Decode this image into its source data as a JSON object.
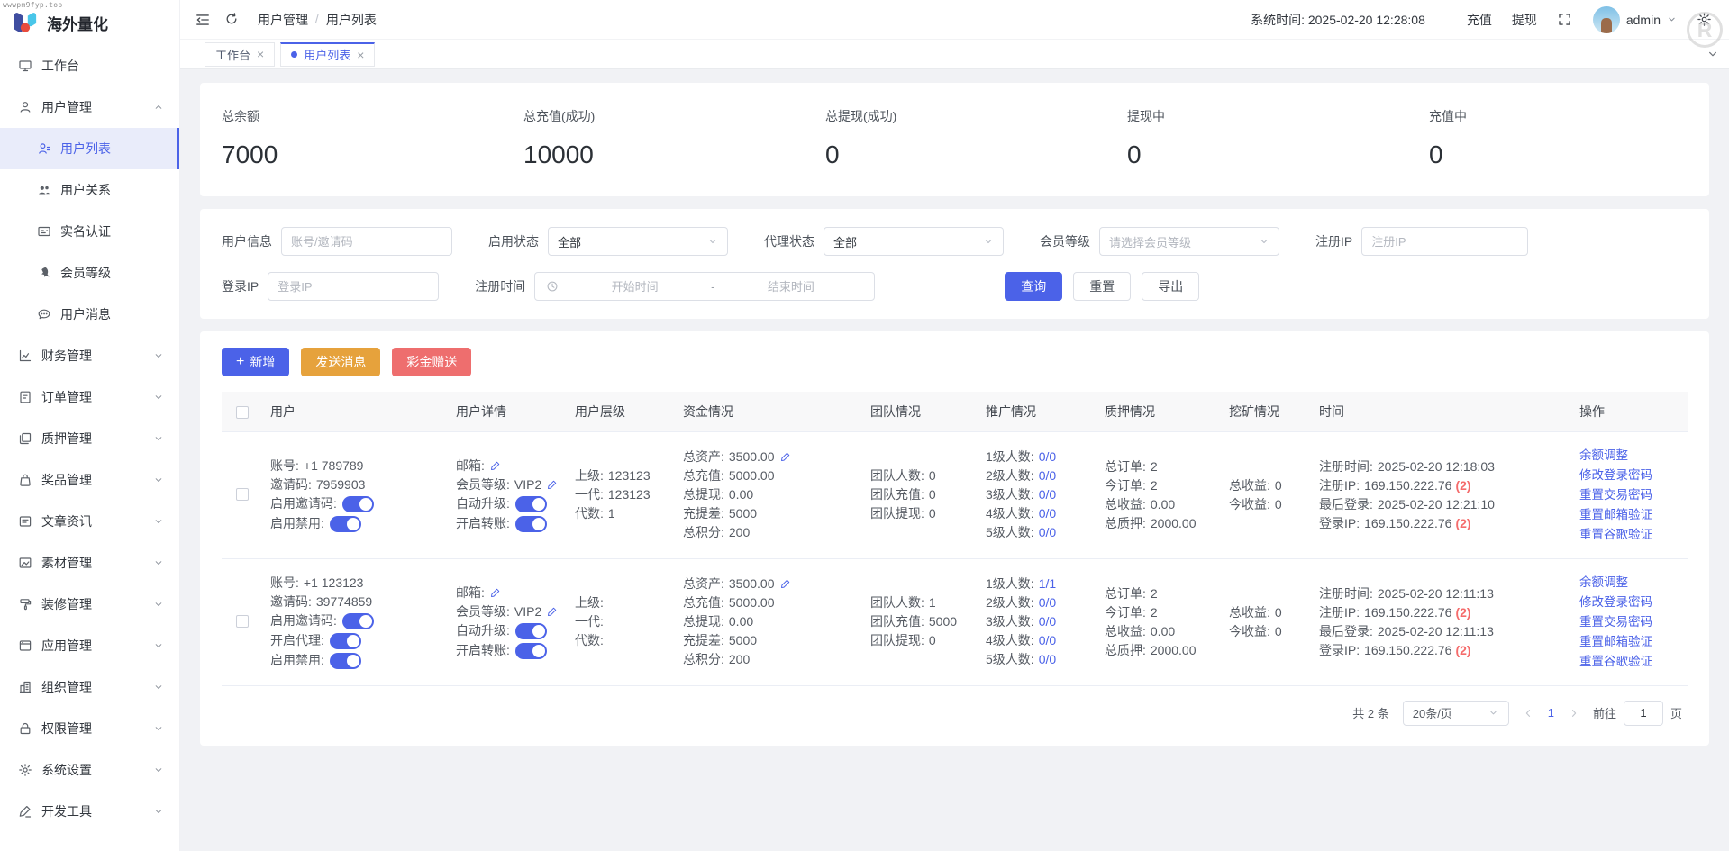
{
  "watermarks": {
    "top_left": "wwwpm9fyp.top",
    "top_right_letter": "R"
  },
  "colors": {
    "primary": "#4b62e8",
    "warning": "#e6a23c",
    "danger": "#ee6e6e",
    "badge_red": "#f56c6c"
  },
  "brand": {
    "name": "海外量化"
  },
  "sidebar": {
    "items": [
      {
        "id": "workbench",
        "label": "工作台",
        "icon": "monitor"
      },
      {
        "id": "user-management",
        "label": "用户管理",
        "icon": "user",
        "group": true,
        "expanded": true
      },
      {
        "id": "user-list",
        "label": "用户列表",
        "icon": "user-list",
        "sub": true,
        "active": true
      },
      {
        "id": "user-relation",
        "label": "用户关系",
        "icon": "users",
        "sub": true
      },
      {
        "id": "real-name-auth",
        "label": "实名认证",
        "icon": "idcard",
        "sub": true
      },
      {
        "id": "member-level",
        "label": "会员等级",
        "icon": "rocket",
        "sub": true
      },
      {
        "id": "user-message",
        "label": "用户消息",
        "icon": "chat",
        "sub": true
      },
      {
        "id": "finance-management",
        "label": "财务管理",
        "icon": "chart",
        "group": true
      },
      {
        "id": "order-management",
        "label": "订单管理",
        "icon": "order",
        "group": true
      },
      {
        "id": "pledge-management",
        "label": "质押管理",
        "icon": "pledge",
        "group": true
      },
      {
        "id": "prize-management",
        "label": "奖品管理",
        "icon": "bag",
        "group": true
      },
      {
        "id": "article-news",
        "label": "文章资讯",
        "icon": "article",
        "group": true
      },
      {
        "id": "material-management",
        "label": "素材管理",
        "icon": "image",
        "group": true
      },
      {
        "id": "decoration-management",
        "label": "装修管理",
        "icon": "paint",
        "group": true
      },
      {
        "id": "app-management",
        "label": "应用管理",
        "icon": "app",
        "group": true
      },
      {
        "id": "org-management",
        "label": "组织管理",
        "icon": "org",
        "group": true
      },
      {
        "id": "permission-management",
        "label": "权限管理",
        "icon": "lock",
        "group": true
      },
      {
        "id": "system-settings",
        "label": "系统设置",
        "icon": "gear",
        "group": true
      },
      {
        "id": "dev-tools",
        "label": "开发工具",
        "icon": "pen",
        "group": true
      }
    ]
  },
  "header": {
    "breadcrumb": [
      "用户管理",
      "用户列表"
    ],
    "system_time_label": "系统时间:",
    "system_time": "2025-02-20 12:28:08",
    "recharge_label": "充值",
    "withdraw_label": "提现",
    "username": "admin",
    "icons": [
      "collapse-menu",
      "refresh",
      "fullscreen",
      "settings-gear"
    ]
  },
  "tabs": [
    {
      "label": "工作台"
    },
    {
      "label": "用户列表",
      "active": true
    }
  ],
  "stats": [
    {
      "label": "总余额",
      "value": "7000"
    },
    {
      "label": "总充值(成功)",
      "value": "10000"
    },
    {
      "label": "总提现(成功)",
      "value": "0"
    },
    {
      "label": "提现中",
      "value": "0"
    },
    {
      "label": "充值中",
      "value": "0"
    }
  ],
  "filters": {
    "user_info": {
      "label": "用户信息",
      "placeholder": "账号/邀请码"
    },
    "enable_status": {
      "label": "启用状态",
      "value": "全部"
    },
    "agent_status": {
      "label": "代理状态",
      "value": "全部"
    },
    "member_level": {
      "label": "会员等级",
      "placeholder": "请选择会员等级"
    },
    "reg_ip": {
      "label": "注册IP",
      "placeholder": "注册IP"
    },
    "login_ip": {
      "label": "登录IP",
      "placeholder": "登录IP"
    },
    "reg_time": {
      "label": "注册时间",
      "start_placeholder": "开始时间",
      "separator": "-",
      "end_placeholder": "结束时间"
    },
    "search_label": "查询",
    "reset_label": "重置",
    "export_label": "导出"
  },
  "toolbar": {
    "add_label": "新增",
    "send_message_label": "发送消息",
    "bonus_label": "彩金赠送"
  },
  "table": {
    "headers": [
      "用户",
      "用户详情",
      "用户层级",
      "资金情况",
      "团队情况",
      "推广情况",
      "质押情况",
      "挖矿情况",
      "时间",
      "操作"
    ],
    "rows": [
      {
        "user": {
          "lines": [
            {
              "k": "账号:",
              "v": "+1 789789"
            },
            {
              "k": "邀请码:",
              "v": "7959903"
            }
          ],
          "toggles": [
            "启用邀请码:",
            "启用禁用:"
          ]
        },
        "detail": {
          "email_k": "邮箱:",
          "level_k": "会员等级:",
          "level_v": "VIP2",
          "toggles": [
            "自动升级:",
            "开启转账:"
          ]
        },
        "hierarchy": [
          {
            "k": "上级:",
            "v": "123123"
          },
          {
            "k": "一代:",
            "v": "123123"
          },
          {
            "k": "代数:",
            "v": "1"
          }
        ],
        "funds": [
          {
            "k": "总资产:",
            "v": "3500.00",
            "edit": true
          },
          {
            "k": "总充值:",
            "v": "5000.00"
          },
          {
            "k": "总提现:",
            "v": "0.00"
          },
          {
            "k": "充提差:",
            "v": "5000"
          },
          {
            "k": "总积分:",
            "v": "200"
          }
        ],
        "team": [
          {
            "k": "团队人数:",
            "v": "0"
          },
          {
            "k": "团队充值:",
            "v": "0"
          },
          {
            "k": "团队提现:",
            "v": "0"
          }
        ],
        "promotion": [
          {
            "k": "1级人数:",
            "v": "0/0"
          },
          {
            "k": "2级人数:",
            "v": "0/0"
          },
          {
            "k": "3级人数:",
            "v": "0/0"
          },
          {
            "k": "4级人数:",
            "v": "0/0"
          },
          {
            "k": "5级人数:",
            "v": "0/0"
          }
        ],
        "pledge": [
          {
            "k": "总订单:",
            "v": "2"
          },
          {
            "k": "今订单:",
            "v": "2"
          },
          {
            "k": "总收益:",
            "v": "0.00"
          },
          {
            "k": "总质押:",
            "v": "2000.00"
          }
        ],
        "mining": [
          {
            "k": "总收益:",
            "v": "0"
          },
          {
            "k": "今收益:",
            "v": "0"
          }
        ],
        "time": [
          {
            "k": "注册时间:",
            "v": "2025-02-20 12:18:03"
          },
          {
            "k": "注册IP:",
            "v": "169.150.222.76",
            "badge": "(2)"
          },
          {
            "k": "最后登录:",
            "v": "2025-02-20 12:21:10"
          },
          {
            "k": "登录IP:",
            "v": "169.150.222.76",
            "badge": "(2)"
          }
        ],
        "actions": [
          "余额调整",
          "修改登录密码",
          "重置交易密码",
          "重置邮箱验证",
          "重置谷歌验证"
        ]
      },
      {
        "user": {
          "lines": [
            {
              "k": "账号:",
              "v": "+1 123123"
            },
            {
              "k": "邀请码:",
              "v": "39774859"
            }
          ],
          "toggles": [
            "启用邀请码:",
            "开启代理:",
            "启用禁用:"
          ]
        },
        "detail": {
          "email_k": "邮箱:",
          "level_k": "会员等级:",
          "level_v": "VIP2",
          "toggles": [
            "自动升级:",
            "开启转账:"
          ]
        },
        "hierarchy": [
          {
            "k": "上级:",
            "v": ""
          },
          {
            "k": "一代:",
            "v": ""
          },
          {
            "k": "代数:",
            "v": ""
          }
        ],
        "funds": [
          {
            "k": "总资产:",
            "v": "3500.00",
            "edit": true
          },
          {
            "k": "总充值:",
            "v": "5000.00"
          },
          {
            "k": "总提现:",
            "v": "0.00"
          },
          {
            "k": "充提差:",
            "v": "5000"
          },
          {
            "k": "总积分:",
            "v": "200"
          }
        ],
        "team": [
          {
            "k": "团队人数:",
            "v": "1"
          },
          {
            "k": "团队充值:",
            "v": "5000"
          },
          {
            "k": "团队提现:",
            "v": "0"
          }
        ],
        "promotion": [
          {
            "k": "1级人数:",
            "v": "1/1"
          },
          {
            "k": "2级人数:",
            "v": "0/0"
          },
          {
            "k": "3级人数:",
            "v": "0/0"
          },
          {
            "k": "4级人数:",
            "v": "0/0"
          },
          {
            "k": "5级人数:",
            "v": "0/0"
          }
        ],
        "pledge": [
          {
            "k": "总订单:",
            "v": "2"
          },
          {
            "k": "今订单:",
            "v": "2"
          },
          {
            "k": "总收益:",
            "v": "0.00"
          },
          {
            "k": "总质押:",
            "v": "2000.00"
          }
        ],
        "mining": [
          {
            "k": "总收益:",
            "v": "0"
          },
          {
            "k": "今收益:",
            "v": "0"
          }
        ],
        "time": [
          {
            "k": "注册时间:",
            "v": "2025-02-20 12:11:13"
          },
          {
            "k": "注册IP:",
            "v": "169.150.222.76",
            "badge": "(2)"
          },
          {
            "k": "最后登录:",
            "v": "2025-02-20 12:11:13"
          },
          {
            "k": "登录IP:",
            "v": "169.150.222.76",
            "badge": "(2)"
          }
        ],
        "actions": [
          "余额调整",
          "修改登录密码",
          "重置交易密码",
          "重置邮箱验证",
          "重置谷歌验证"
        ]
      }
    ]
  },
  "pagination": {
    "total_label": "共 2 条",
    "page_size": "20条/页",
    "current_page": "1",
    "goto_label": "前往",
    "unit_label": "页"
  }
}
